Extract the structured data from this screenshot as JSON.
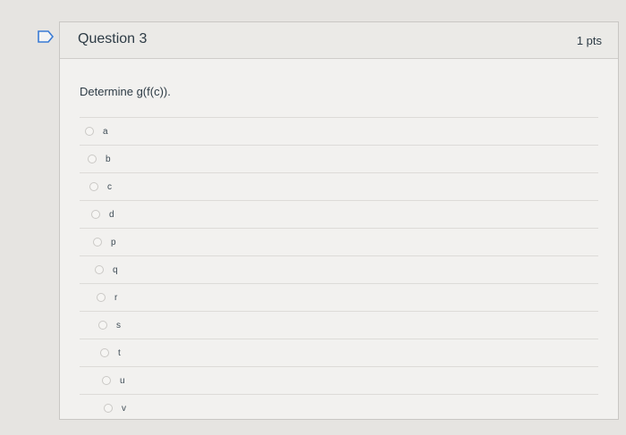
{
  "question": {
    "title": "Question 3",
    "points": "1 pts",
    "prompt": "Determine g(f(c))."
  },
  "answers": [
    "a",
    "b",
    "c",
    "d",
    "p",
    "q",
    "r",
    "s",
    "t",
    "u",
    "v"
  ]
}
